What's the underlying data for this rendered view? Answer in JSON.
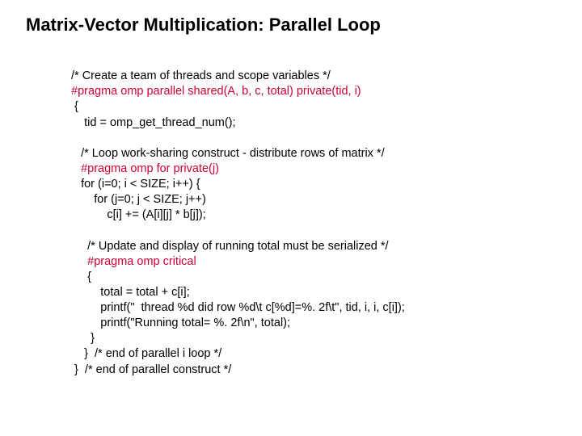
{
  "title": "Matrix-Vector Multiplication: Parallel Loop",
  "code": {
    "l1": "/* Create a team of threads and scope variables */",
    "p1": "#pragma omp parallel shared(A, b, c, total) private(tid, i)",
    "l2": " {",
    "l3": "    tid = omp_get_thread_num();",
    "blank1": "",
    "l4": "   /* Loop work-sharing construct - distribute rows of matrix */",
    "p2": "   #pragma omp for private(j)",
    "l5": "   for (i=0; i < SIZE; i++) {",
    "l6": "       for (j=0; j < SIZE; j++)",
    "l7": "           c[i] += (A[i][j] * b[j]);",
    "blank2": "",
    "l8": "     /* Update and display of running total must be serialized */",
    "p3": "     #pragma omp critical",
    "l9": "     {",
    "l10": "         total = total + c[i];",
    "l11": "         printf(\"  thread %d did row %d\\t c[%d]=%. 2f\\t\", tid, i, i, c[i]);",
    "l12": "         printf(\"Running total= %. 2f\\n\", total);",
    "l13": "      }",
    "l14": "    }  /* end of parallel i loop */",
    "l15": " }  /* end of parallel construct */"
  }
}
